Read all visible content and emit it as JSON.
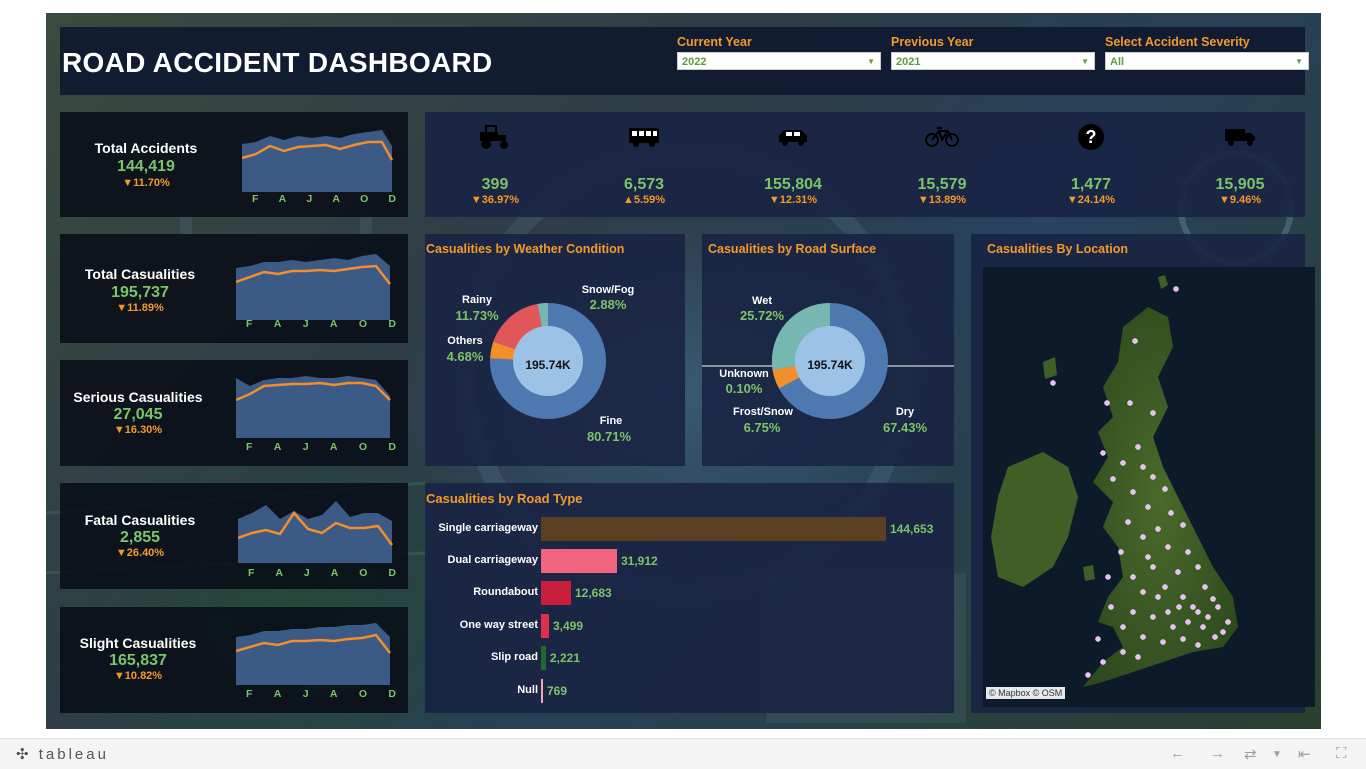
{
  "dashboard": {
    "title": "ROAD ACCIDENT DASHBOARD"
  },
  "filters": [
    {
      "label": "Current Year",
      "value": "2022"
    },
    {
      "label": "Previous Year",
      "value": "2021"
    },
    {
      "label": "Select Accident Severity",
      "value": "All"
    }
  ],
  "kpis": [
    {
      "name": "Total Accidents",
      "value": "144,419",
      "change": "▼11.70%"
    },
    {
      "name": "Total Casualities",
      "value": "195,737",
      "change": "▼11.89%"
    },
    {
      "name": "Serious Casualities",
      "value": "27,045",
      "change": "▼16.30%"
    },
    {
      "name": "Fatal Casualities",
      "value": "2,855",
      "change": "▼26.40%"
    },
    {
      "name": "Slight Casualities",
      "value": "165,837",
      "change": "▼10.82%"
    }
  ],
  "spark_months": [
    "F",
    "A",
    "J",
    "A",
    "O",
    "D"
  ],
  "vehicles": [
    {
      "icon": "tractor-icon",
      "value": "399",
      "change": "▼36.97%"
    },
    {
      "icon": "bus-icon",
      "value": "6,573",
      "change": "▲5.59%"
    },
    {
      "icon": "car-icon",
      "value": "155,804",
      "change": "▼12.31%"
    },
    {
      "icon": "bicycle-icon",
      "value": "15,579",
      "change": "▼13.89%"
    },
    {
      "icon": "question-icon",
      "value": "1,477",
      "change": "▼24.14%"
    },
    {
      "icon": "truck-icon",
      "value": "15,905",
      "change": "▼9.46%"
    }
  ],
  "weather": {
    "title": "Casualities by Weather Condition",
    "center": "195.74K",
    "labels": [
      {
        "name": "Rainy",
        "pct": "11.73%"
      },
      {
        "name": "Snow/Fog",
        "pct": "2.88%"
      },
      {
        "name": "Others",
        "pct": "4.68%"
      },
      {
        "name": "Fine",
        "pct": "80.71%"
      }
    ]
  },
  "surface": {
    "title": "Casualities by Road Surface",
    "center": "195.74K",
    "labels": [
      {
        "name": "Wet",
        "pct": "25.72%"
      },
      {
        "name": "Unknown",
        "pct": "0.10%"
      },
      {
        "name": "Frost/Snow",
        "pct": "6.75%"
      },
      {
        "name": "Dry",
        "pct": "67.43%"
      }
    ]
  },
  "location": {
    "title": "Casualities By Location",
    "attribution": "© Mapbox  © OSM"
  },
  "road_type": {
    "title": "Casualities by Road Type",
    "rows": [
      {
        "label": "Single carriageway",
        "value": "144,653"
      },
      {
        "label": "Dual carriageway",
        "value": "31,912"
      },
      {
        "label": "Roundabout",
        "value": "12,683"
      },
      {
        "label": "One way street",
        "value": "3,499"
      },
      {
        "label": "Slip road",
        "value": "2,221"
      },
      {
        "label": "Null",
        "value": "769"
      }
    ]
  },
  "colors": {
    "orange": "#f39a2b",
    "green": "#7cc46a",
    "donut_main": "#4e79b0",
    "donut_rainy": "#e15759",
    "donut_others": "#f28e2b",
    "donut_snow": "#76b7b2",
    "bar_single": "#5a3f22",
    "bar_dual": "#f0647d",
    "bar_round": "#c8203c",
    "bar_oneway": "#e0304e",
    "bar_slip": "#1f6a2c",
    "bar_null": "#f7a3b6"
  },
  "footer": {
    "logo": "tableau"
  }
}
